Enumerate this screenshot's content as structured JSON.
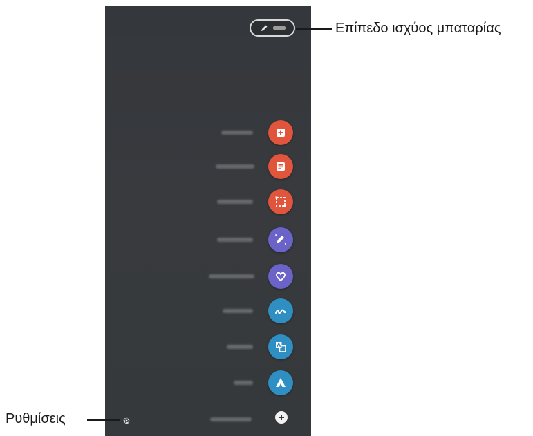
{
  "callouts": {
    "battery": "Επίπεδο ισχύος μπαταρίας",
    "settings": "Ρυθμίσεις"
  },
  "colors": {
    "panel": "#36393c",
    "red": "#e0553b",
    "purple": "#6b63c8",
    "teal": "#2f8fc2"
  },
  "menu": {
    "items": [
      {
        "icon": "create-note-icon",
        "color": "#e0553b"
      },
      {
        "icon": "view-notes-icon",
        "color": "#e0553b"
      },
      {
        "icon": "smart-select-icon",
        "color": "#e0553b"
      },
      {
        "icon": "screen-write-icon",
        "color": "#6b63c8"
      },
      {
        "icon": "live-message-icon",
        "color": "#6b63c8"
      },
      {
        "icon": "ar-doodle-icon",
        "color": "#2f8fc2"
      },
      {
        "icon": "translate-icon",
        "color": "#2f8fc2"
      },
      {
        "icon": "bixby-vision-icon",
        "color": "#2f8fc2"
      }
    ],
    "add_icon": "add-icon"
  }
}
